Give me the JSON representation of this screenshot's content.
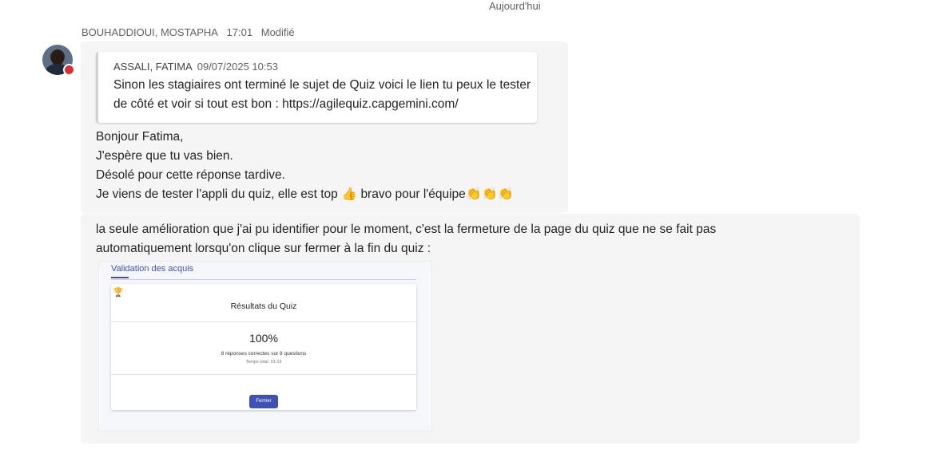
{
  "date_divider": "Aujourd'hui",
  "message1": {
    "author": "BOUHADDIOUI, MOSTAPHA",
    "time": "17:01",
    "edited": "Modifié",
    "quote": {
      "author": "ASSALI, FATIMA",
      "timestamp": "09/07/2025 10:53",
      "text": "Sinon les stagiaires ont terminé le sujet de Quiz voici le lien tu peux le tester de côté et voir si tout est bon : https://agilequiz.capgemini.com/"
    },
    "lines": [
      "Bonjour Fatima,",
      "J'espère que tu vas bien.",
      "Désolé pour cette réponse tardive.",
      "Je viens de tester l'appli du quiz, elle est top"
    ],
    "line4_suffix": "bravo pour l'équipe",
    "emojis": {
      "thumb": "👍",
      "clap": "👏"
    }
  },
  "message2": {
    "text": "la seule amélioration que j'ai pu identifier pour le moment, c'est la fermeture de la page du quiz que ne se fait pas automatiquement lorsqu'on clique sur fermer à la fin du quiz :",
    "screenshot": {
      "tab": "Validation des acquis",
      "title": "Résultats du Quiz",
      "score": "100%",
      "correct": "8 réponses correctes sur 8 questions",
      "time": "Temps total: 01:19",
      "close_button": "Fermer",
      "accent": "#3f51b5"
    }
  },
  "colors": {
    "bubble": "#f5f5f5",
    "status_busy": "#d13438"
  }
}
